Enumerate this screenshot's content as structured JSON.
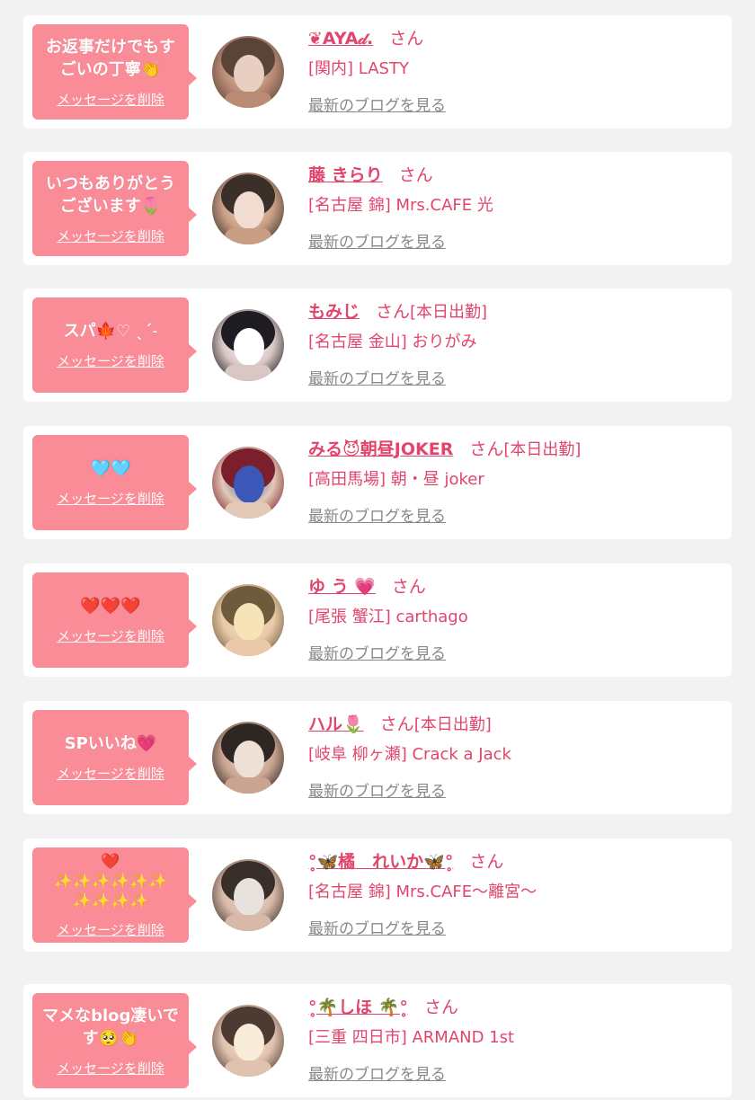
{
  "messages": [
    {
      "message": "お返事だけでもす\nごいの丁寧👏",
      "delete_label": "メッセージを削除",
      "name": "❦AYA𝒹.",
      "honorific": "さん",
      "status": "",
      "shop": "[関内] LASTY",
      "blog_label": "最新のブログを見る",
      "avatar_colors": [
        "#5a4438",
        "#b98a74",
        "#e7cfc2"
      ]
    },
    {
      "message": "いつもありがとう\nございます🌷",
      "delete_label": "メッセージを削除",
      "name": "藤 きらり",
      "honorific": "さん",
      "status": "",
      "shop": "[名古屋 錦] Mrs.CAFE 光",
      "blog_label": "最新のブログを見る",
      "avatar_colors": [
        "#3b2f2a",
        "#c99e84",
        "#f0dcd0"
      ]
    },
    {
      "message": "スパ🍁♡ ˎˊ˗",
      "delete_label": "メッセージを削除",
      "name": "もみじ",
      "honorific": "さん",
      "status": "[本日出勤]",
      "shop": "[名古屋 金山] おりがみ",
      "blog_label": "最新のブログを見る",
      "avatar_colors": [
        "#1e1c22",
        "#d9c7c4",
        "#ffffff"
      ]
    },
    {
      "message": "🩵🩵",
      "delete_label": "メッセージを削除",
      "name": "みる😈朝昼JOKER",
      "honorific": "さん",
      "status": "[本日出勤]",
      "shop": "[高田馬場] 朝・昼 joker",
      "blog_label": "最新のブログを見る",
      "avatar_colors": [
        "#7a1f2b",
        "#e3c9b6",
        "#3b58b8"
      ]
    },
    {
      "message": "❤️❤️❤️",
      "delete_label": "メッセージを削除",
      "name": "ゆ う 💗",
      "honorific": "さん",
      "status": "",
      "shop": "[尾張 蟹江] carthago",
      "blog_label": "最新のブログを見る",
      "avatar_colors": [
        "#6e5a3c",
        "#e9c9a8",
        "#f6e3b8"
      ]
    },
    {
      "message": "SPいいね💗",
      "delete_label": "メッセージを削除",
      "name": "ハル🌷",
      "honorific": "さん",
      "status": "[本日出勤]",
      "shop": "[岐阜 柳ヶ瀬] Crack a Jack",
      "blog_label": "最新のブログを見る",
      "avatar_colors": [
        "#2e2622",
        "#caa491",
        "#efe0d6"
      ]
    },
    {
      "message": "❤️\n✨✨✨✨✨✨\n✨✨✨✨",
      "delete_label": "メッセージを削除",
      "name": "°̥🦋橘　れいか🦋°̥",
      "honorific": "さん",
      "status": "",
      "shop": "[名古屋 錦] Mrs.CAFE〜離宮〜",
      "blog_label": "最新のブログを見る",
      "avatar_colors": [
        "#3a2e2b",
        "#d8b9a8",
        "#e8e2de"
      ]
    },
    {
      "message": "マメなblog凄いで\nす🥺👏",
      "delete_label": "メッセージを削除",
      "name": "°̥🌴しほ 🌴°̥",
      "honorific": "さん",
      "status": "",
      "shop": "[三重 四日市] ARMAND 1st",
      "blog_label": "最新のブログを見る",
      "avatar_colors": [
        "#4c3a33",
        "#e0c2ae",
        "#f8ecd8"
      ]
    }
  ]
}
